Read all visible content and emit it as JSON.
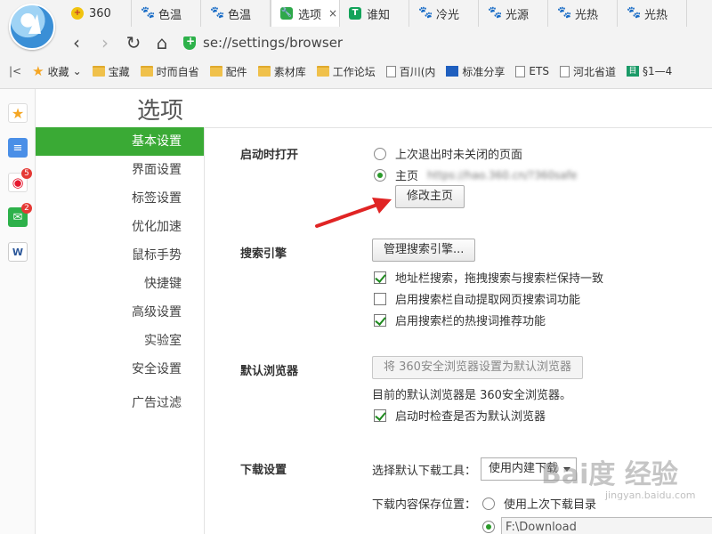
{
  "browser": {
    "tabs": [
      {
        "label": "360",
        "icon": "360-icon",
        "active": false
      },
      {
        "label": "色温",
        "icon": "paw-icon",
        "active": false
      },
      {
        "label": "色温",
        "icon": "paw-icon",
        "active": false
      },
      {
        "label": "选项",
        "icon": "wrench-icon",
        "active": true,
        "close": "×"
      },
      {
        "label": "谁知",
        "icon": "tq-icon",
        "active": false
      },
      {
        "label": "冷光",
        "icon": "paw-icon",
        "active": false
      },
      {
        "label": "光源",
        "icon": "paw-icon",
        "active": false
      },
      {
        "label": "光热",
        "icon": "paw-icon",
        "active": false
      },
      {
        "label": "光热",
        "icon": "paw-icon",
        "active": false
      }
    ],
    "nav": {
      "back": "‹",
      "forward": "›",
      "reload": "↻",
      "home": "⌂"
    },
    "address": "se://settings/browser",
    "bookmarks": {
      "collapse": "|<",
      "favorites": "收藏",
      "favorites_caret": "⌄",
      "items": [
        {
          "label": "宝藏",
          "icon": "folder-icon"
        },
        {
          "label": "时而自省",
          "icon": "folder-icon"
        },
        {
          "label": "配件",
          "icon": "folder-icon"
        },
        {
          "label": "素材库",
          "icon": "folder-icon"
        },
        {
          "label": "工作论坛",
          "icon": "folder-icon"
        },
        {
          "label": "百川(内",
          "icon": "page-icon"
        },
        {
          "label": "标准分享",
          "icon": "bm-blue-icon"
        },
        {
          "label": "ETS",
          "icon": "page-icon"
        },
        {
          "label": "河北省道",
          "icon": "page-icon"
        },
        {
          "label": "§1—4",
          "icon": "bm-green-icon"
        }
      ]
    }
  },
  "quickbar": {
    "weibo_badge": "5",
    "mail_badge": "2"
  },
  "settings": {
    "title": "选项",
    "menu": [
      "基本设置",
      "界面设置",
      "标签设置",
      "优化加速",
      "鼠标手势",
      "快捷键",
      "高级设置",
      "实验室",
      "安全设置",
      "广告过滤"
    ],
    "active_menu": "基本设置",
    "startup": {
      "label": "启动时打开",
      "option_last": "上次退出时未关闭的页面",
      "option_home": "主页",
      "home_url": "https://hao.360.cn/?360safe",
      "change_home_button": "修改主页"
    },
    "search": {
      "label": "搜索引擎",
      "manage_button": "管理搜索引擎...",
      "opt1": "地址栏搜索，拖拽搜索与搜索栏保持一致",
      "opt2": "启用搜索栏自动提取网页搜索词功能",
      "opt3": "启用搜索栏的热搜词推荐功能",
      "opt1_checked": true,
      "opt2_checked": false,
      "opt3_checked": true
    },
    "default_browser": {
      "label": "默认浏览器",
      "set_button": "将 360安全浏览器设置为默认浏览器",
      "status": "目前的默认浏览器是 360安全浏览器。",
      "check_option": "启动时检查是否为默认浏览器",
      "check_checked": true
    },
    "download": {
      "label": "下载设置",
      "tool_label": "选择默认下载工具：",
      "tool_value": "使用内建下载",
      "location_label": "下载内容保存位置：",
      "opt_last": "使用上次下载目录",
      "path": "F:\\Download"
    }
  },
  "watermark": {
    "text": "Bai度 经验",
    "sub": "jingyan.baidu.com"
  }
}
